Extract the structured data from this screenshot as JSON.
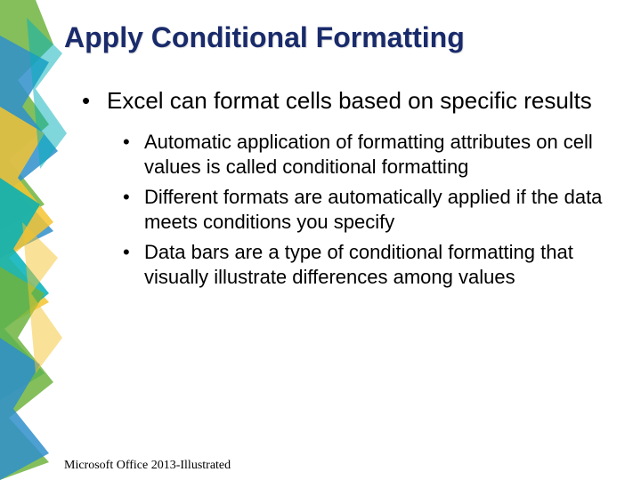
{
  "title": "Apply Conditional Formatting",
  "bullets": {
    "l1": "Excel can format cells based on specific results",
    "l2a": "Automatic application of formatting attributes on cell values is called conditional formatting",
    "l2b": "Different formats are automatically applied if the data meets conditions you specify",
    "l2c": "Data bars are a type of conditional formatting that visually illustrate differences among values"
  },
  "footer": "Microsoft Office 2013-Illustrated"
}
